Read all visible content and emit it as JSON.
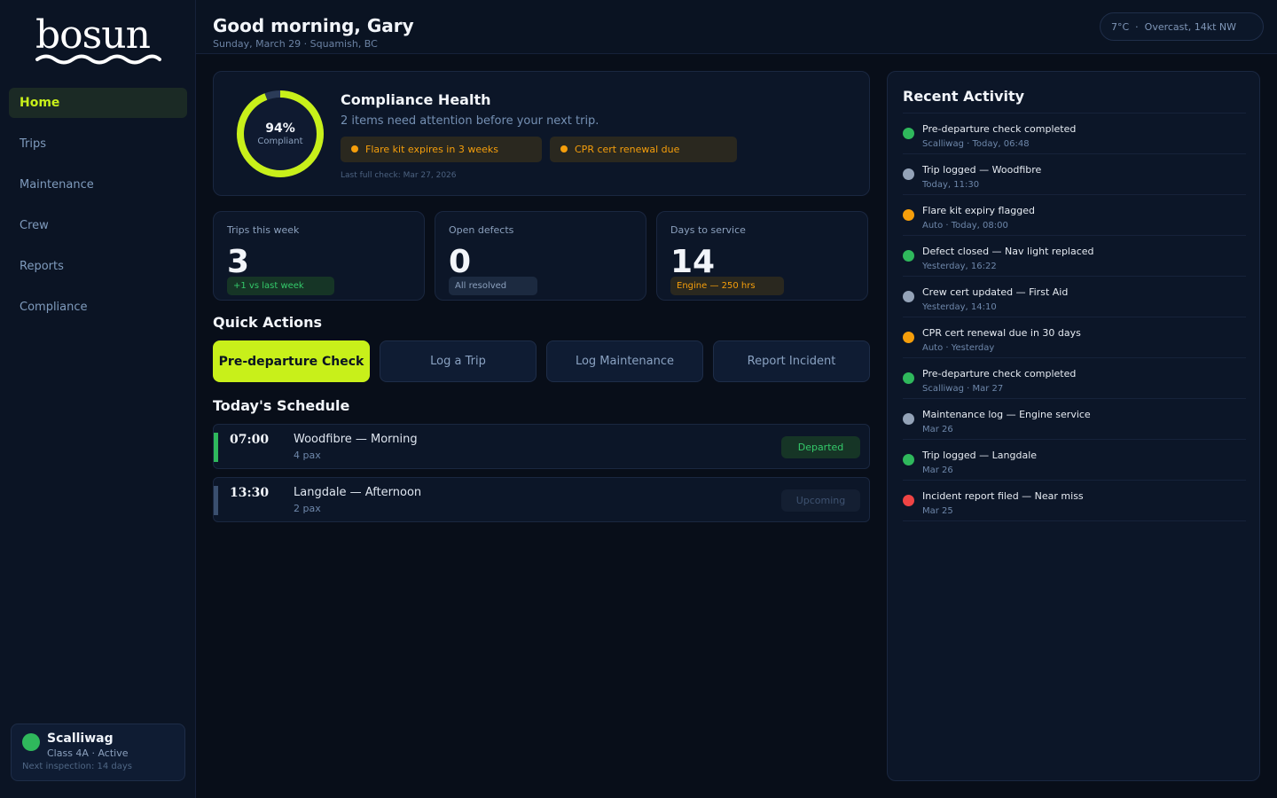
{
  "brand": {
    "logo_text": "bosun"
  },
  "sidebar": {
    "items": [
      {
        "label": "Home",
        "active": true
      },
      {
        "label": "Trips"
      },
      {
        "label": "Maintenance"
      },
      {
        "label": "Crew"
      },
      {
        "label": "Reports"
      },
      {
        "label": "Compliance"
      }
    ],
    "vessel": {
      "name": "Scalliwag",
      "class_status": "Class 4A  ·  Active",
      "next_inspection": "Next inspection: 14 days",
      "status_color": "#2fb85c"
    }
  },
  "header": {
    "greeting": "Good morning, Gary",
    "date_location": "Sunday, March 29 · Squamish, BC",
    "weather": "7°C  ·  Overcast, 14kt NW"
  },
  "compliance": {
    "percent": "94%",
    "percent_value": 94,
    "label": "Compliant",
    "title": "Compliance Health",
    "subtitle": "2 items need attention before your next trip.",
    "alerts": [
      "Flare kit expires in 3 weeks",
      "CPR cert renewal due"
    ],
    "last_check": "Last full check: Mar 27, 2026",
    "accent": "#c8f01a"
  },
  "stats": [
    {
      "label": "Trips this week",
      "value": "3",
      "badge": "+1 vs last week"
    },
    {
      "label": "Open defects",
      "value": "0",
      "badge": "All resolved"
    },
    {
      "label": "Days to service",
      "value": "14",
      "badge": "Engine — 250 hrs"
    }
  ],
  "quick_actions": {
    "title": "Quick Actions",
    "buttons": [
      "Pre-departure Check",
      "Log a Trip",
      "Log Maintenance",
      "Report Incident"
    ]
  },
  "schedule": {
    "title": "Today's Schedule",
    "rows": [
      {
        "time": "07:00",
        "route": "Woodfibre — Morning",
        "pax": "4 pax",
        "status": "Departed",
        "color": "#2fb85c"
      },
      {
        "time": "13:30",
        "route": "Langdale — Afternoon",
        "pax": "2 pax",
        "status": "Upcoming",
        "color": "#3a4f6e"
      }
    ]
  },
  "activity": {
    "title": "Recent Activity",
    "items": [
      {
        "text": "Pre-departure check completed",
        "meta": "Scalliwag · Today, 06:48",
        "color": "#2fb85c"
      },
      {
        "text": "Trip logged — Woodfibre",
        "meta": "Today, 11:30",
        "color": "#94a3b8"
      },
      {
        "text": "Flare kit expiry flagged",
        "meta": "Auto · Today, 08:00",
        "color": "#f59e0b"
      },
      {
        "text": "Defect closed — Nav light replaced",
        "meta": "Yesterday, 16:22",
        "color": "#2fb85c"
      },
      {
        "text": "Crew cert updated — First Aid",
        "meta": "Yesterday, 14:10",
        "color": "#94a3b8"
      },
      {
        "text": "CPR cert renewal due in 30 days",
        "meta": "Auto · Yesterday",
        "color": "#f59e0b"
      },
      {
        "text": "Pre-departure check completed",
        "meta": "Scalliwag · Mar 27",
        "color": "#2fb85c"
      },
      {
        "text": "Maintenance log — Engine service",
        "meta": "Mar 26",
        "color": "#94a3b8"
      },
      {
        "text": "Trip logged — Langdale",
        "meta": "Mar 26",
        "color": "#2fb85c"
      },
      {
        "text": "Incident report filed — Near miss",
        "meta": "Mar 25",
        "color": "#ef4444"
      }
    ]
  }
}
